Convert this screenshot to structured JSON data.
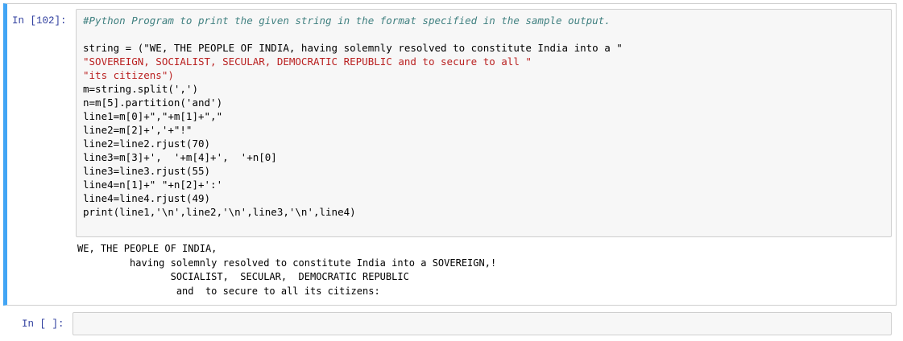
{
  "cell1": {
    "prompt": "In [102]:",
    "code_lines": [
      "#Python Program to print the given string in the format specified in the sample output.",
      "",
      "string = (\"WE, THE PEOPLE OF INDIA, having solemnly resolved to constitute India into a \"",
      "\"SOVEREIGN, SOCIALIST, SECULAR, DEMOCRATIC REPUBLIC and to secure to all \"",
      "\"its citizens\")",
      "m=string.split(',')",
      "n=m[5].partition('and')",
      "line1=m[0]+\",\"+m[1]+\",\"",
      "line2=m[2]+','+\"!\"",
      "line2=line2.rjust(70)",
      "line3=m[3]+',  '+m[4]+',  '+n[0]",
      "line3=line3.rjust(55)",
      "line4=n[1]+\" \"+n[2]+':'",
      "line4=line4.rjust(49)",
      "print(line1,'\\n',line2,'\\n',line3,'\\n',line4)"
    ],
    "output_lines": [
      "WE, THE PEOPLE OF INDIA,",
      "         having solemnly resolved to constitute India into a SOVEREIGN,!",
      "                SOCIALIST,  SECULAR,  DEMOCRATIC REPUBLIC",
      "                 and  to secure to all its citizens:"
    ]
  },
  "cell2": {
    "prompt": "In [ ]:",
    "code": ""
  }
}
